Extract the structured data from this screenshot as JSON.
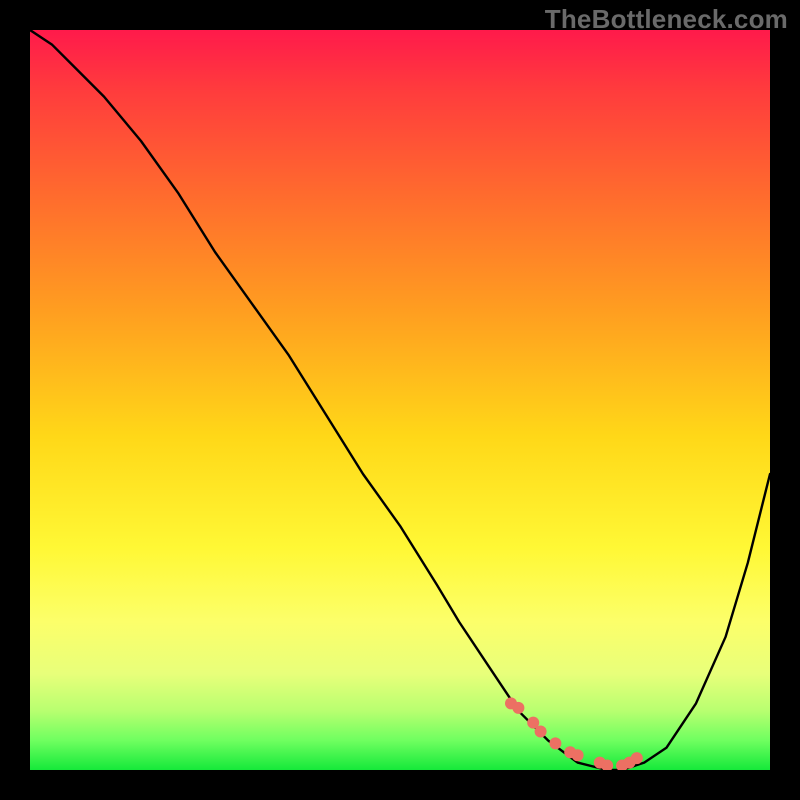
{
  "watermark": "TheBottleneck.com",
  "chart_data": {
    "type": "line",
    "title": "",
    "xlabel": "",
    "ylabel": "",
    "xlim": [
      0,
      100
    ],
    "ylim": [
      0,
      100
    ],
    "grid": false,
    "legend": false,
    "series": [
      {
        "name": "bottleneck-curve",
        "x": [
          0,
          3,
          6,
          10,
          15,
          20,
          25,
          30,
          35,
          40,
          45,
          50,
          55,
          58,
          62,
          66,
          70,
          74,
          78,
          80,
          83,
          86,
          90,
          94,
          97,
          100
        ],
        "y": [
          100,
          98,
          95,
          91,
          85,
          78,
          70,
          63,
          56,
          48,
          40,
          33,
          25,
          20,
          14,
          8,
          4,
          1,
          0,
          0,
          1,
          3,
          9,
          18,
          28,
          40
        ]
      }
    ],
    "markers": {
      "name": "optimal-range",
      "color": "#ec7063",
      "x": [
        65,
        66,
        68,
        69,
        71,
        73,
        74,
        77,
        78,
        80,
        81,
        82
      ],
      "y": [
        9,
        8.4,
        6.4,
        5.2,
        3.6,
        2.4,
        2,
        1,
        0.6,
        0.6,
        1,
        1.6
      ]
    }
  }
}
